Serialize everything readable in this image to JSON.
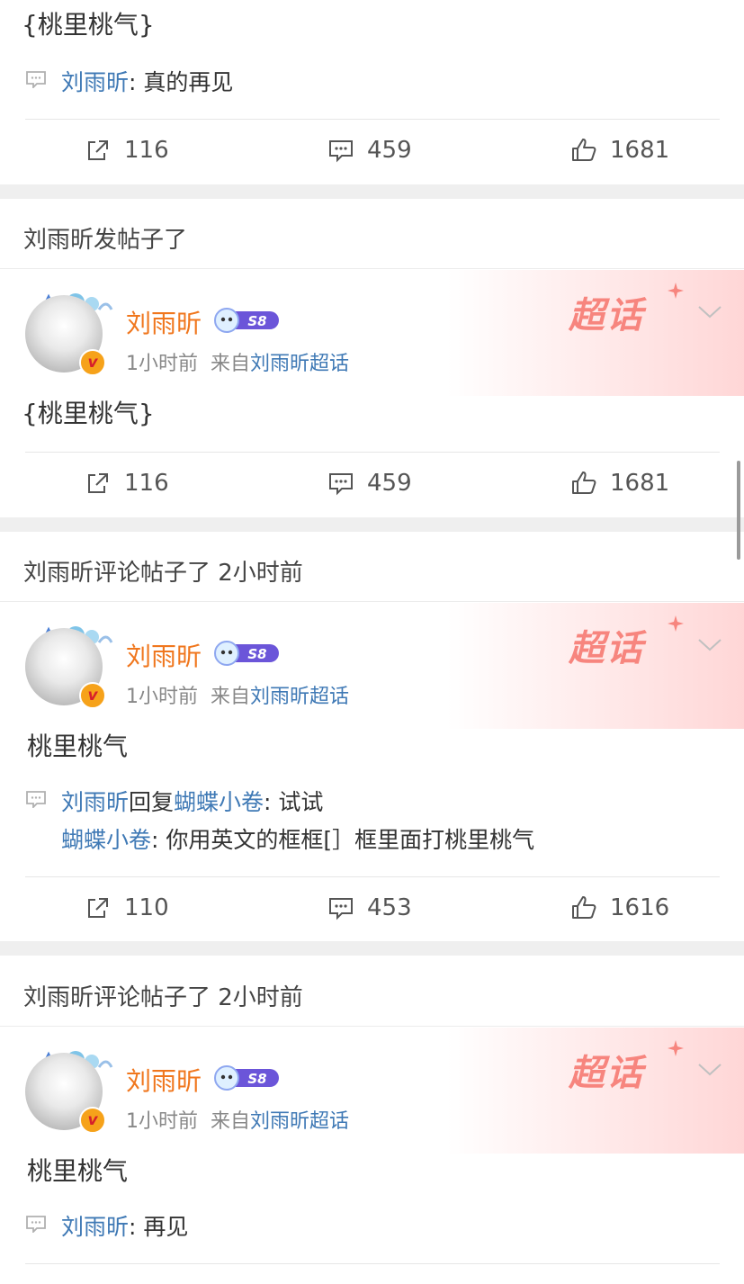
{
  "posts": [
    {
      "body": "{桃里桃气}",
      "comments": [
        {
          "user": "刘雨昕",
          "text": ": 真的再见"
        }
      ],
      "forward": "116",
      "comment_count": "459",
      "like": "1681"
    },
    {
      "section_title": "刘雨昕发帖子了",
      "author": "刘雨昕",
      "level": "S8",
      "time": "1小时前",
      "from_prefix": "来自",
      "from_link": "刘雨昕超话",
      "body": "{桃里桃气}",
      "forward": "116",
      "comment_count": "459",
      "like": "1681"
    },
    {
      "section_title": "刘雨昕评论帖子了 2小时前",
      "author": "刘雨昕",
      "level": "S8",
      "time": "1小时前",
      "from_prefix": "来自",
      "from_link": "刘雨昕超话",
      "body": "桃里桃气",
      "reply": {
        "user1": "刘雨昕",
        "verb": "回复",
        "user2": "蝴蝶小卷",
        "text1": ": 试试",
        "quoted_user": "蝴蝶小卷",
        "text2": ": 你用英文的框框[］框里面打桃里桃气"
      },
      "forward": "110",
      "comment_count": "453",
      "like": "1616"
    },
    {
      "section_title": "刘雨昕评论帖子了 2小时前",
      "author": "刘雨昕",
      "level": "S8",
      "time": "1小时前",
      "from_prefix": "来自",
      "from_link": "刘雨昕超话",
      "body": "桃里桃气",
      "comments": [
        {
          "user": "刘雨昕",
          "text": ": 再见"
        }
      ]
    }
  ],
  "supertopic_badge": "超话",
  "icons": [
    "share-icon",
    "comment-icon",
    "like-icon",
    "chevron-down-icon",
    "verified-badge-icon"
  ]
}
